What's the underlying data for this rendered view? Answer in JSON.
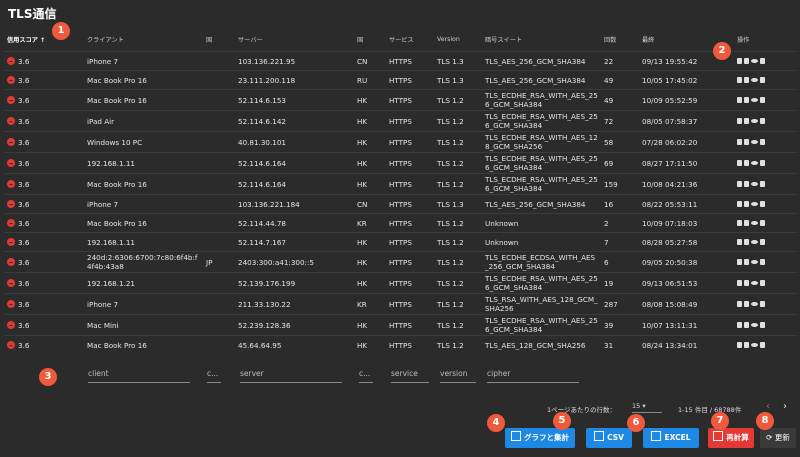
{
  "title": "TLS通信",
  "columns": [
    "信用スコア ↑",
    "クライアント",
    "国",
    "サーバー",
    "国",
    "サービス",
    "Version",
    "暗号スイート",
    "回数",
    "最終",
    "操作"
  ],
  "rows": [
    [
      "3.6",
      "iPhone 7",
      "",
      "103.136.221.95",
      "CN",
      "HTTPS",
      "TLS 1.3",
      "TLS_AES_256_GCM_SHA384",
      "22",
      "09/13 19:55:42"
    ],
    [
      "3.6",
      "Mac Book Pro 16",
      "",
      "23.111.200.118",
      "RU",
      "HTTPS",
      "TLS 1.3",
      "TLS_AES_256_GCM_SHA384",
      "49",
      "10/05 17:45:02"
    ],
    [
      "3.6",
      "Mac Book Pro 16",
      "",
      "52.114.6.153",
      "HK",
      "HTTPS",
      "TLS 1.2",
      "TLS_ECDHE_RSA_WITH_AES_256_GCM_SHA384",
      "49",
      "10/09 05:52:59"
    ],
    [
      "3.6",
      "iPad Air",
      "",
      "52.114.6.142",
      "HK",
      "HTTPS",
      "TLS 1.2",
      "TLS_ECDHE_RSA_WITH_AES_256_GCM_SHA384",
      "72",
      "08/05 07:58:37"
    ],
    [
      "3.6",
      "Windows 10 PC",
      "",
      "40.81.30.101",
      "HK",
      "HTTPS",
      "TLS 1.2",
      "TLS_ECDHE_RSA_WITH_AES_128_GCM_SHA256",
      "58",
      "07/28 06:02:20"
    ],
    [
      "3.6",
      "192.168.1.11",
      "",
      "52.114.6.164",
      "HK",
      "HTTPS",
      "TLS 1.2",
      "TLS_ECDHE_RSA_WITH_AES_256_GCM_SHA384",
      "69",
      "08/27 17:11:50"
    ],
    [
      "3.6",
      "Mac Book Pro 16",
      "",
      "52.114.6.164",
      "HK",
      "HTTPS",
      "TLS 1.2",
      "TLS_ECDHE_RSA_WITH_AES_256_GCM_SHA384",
      "159",
      "10/08 04:21:36"
    ],
    [
      "3.6",
      "iPhone 7",
      "",
      "103.136.221.184",
      "CN",
      "HTTPS",
      "TLS 1.3",
      "TLS_AES_256_GCM_SHA384",
      "16",
      "08/22 05:53:11"
    ],
    [
      "3.6",
      "Mac Book Pro 16",
      "",
      "52.114.44.78",
      "KR",
      "HTTPS",
      "TLS 1.2",
      "Unknown",
      "2",
      "10/09 07:18:03"
    ],
    [
      "3.6",
      "192.168.1.11",
      "",
      "52.114.7.167",
      "HK",
      "HTTPS",
      "TLS 1.2",
      "Unknown",
      "7",
      "08/28 05:27:58"
    ],
    [
      "3.6",
      "240d:2:6306:6700:7c80:6f4b:f4f4b:43a8",
      "JP",
      "2403:300:a41:300::5",
      "HK",
      "HTTPS",
      "TLS 1.2",
      "TLS_ECDHE_ECDSA_WITH_AES_256_GCM_SHA384",
      "6",
      "09/05 20:50:38"
    ],
    [
      "3.6",
      "192.168.1.21",
      "",
      "52.139.176.199",
      "HK",
      "HTTPS",
      "TLS 1.2",
      "TLS_ECDHE_RSA_WITH_AES_256_GCM_SHA384",
      "19",
      "09/13 06:51:53"
    ],
    [
      "3.6",
      "iPhone 7",
      "",
      "211.33.130.22",
      "KR",
      "HTTPS",
      "TLS 1.2",
      "TLS_RSA_WITH_AES_128_GCM_SHA256",
      "287",
      "08/08 15:08:49"
    ],
    [
      "3.6",
      "Mac Mini",
      "",
      "52.239.128.36",
      "HK",
      "HTTPS",
      "TLS 1.2",
      "TLS_ECDHE_RSA_WITH_AES_256_GCM_SHA384",
      "39",
      "10/07 13:11:31"
    ],
    [
      "3.6",
      "Mac Book Pro 16",
      "",
      "45.64.64.95",
      "HK",
      "HTTPS",
      "TLS 1.2",
      "TLS_AES_128_GCM_SHA256",
      "31",
      "08/24 13:34:01"
    ]
  ],
  "ops_icons": [
    "sitemap-icon",
    "file-icon",
    "eye-icon",
    "trash-icon"
  ],
  "filters": {
    "client": "client",
    "c1": "c...",
    "server": "server",
    "c2": "c...",
    "service": "service",
    "version": "version",
    "cipher": "cipher"
  },
  "pager": {
    "rows_label": "1ページあたりの行数：",
    "rows_value": "15",
    "range": "1-15 件目 / 68788件"
  },
  "buttons": {
    "chart": "グラフと集計",
    "csv": "CSV",
    "excel": "EXCEL",
    "recalc": "再計算",
    "refresh": "更新"
  },
  "badges": [
    "1",
    "2",
    "3",
    "4",
    "5",
    "6",
    "7",
    "8"
  ],
  "colors": {
    "background": "#2b2b2b",
    "badge": "#ef5a3c",
    "button_blue": "#1e88e5",
    "button_red": "#e53935",
    "score_red": "#e53935"
  }
}
